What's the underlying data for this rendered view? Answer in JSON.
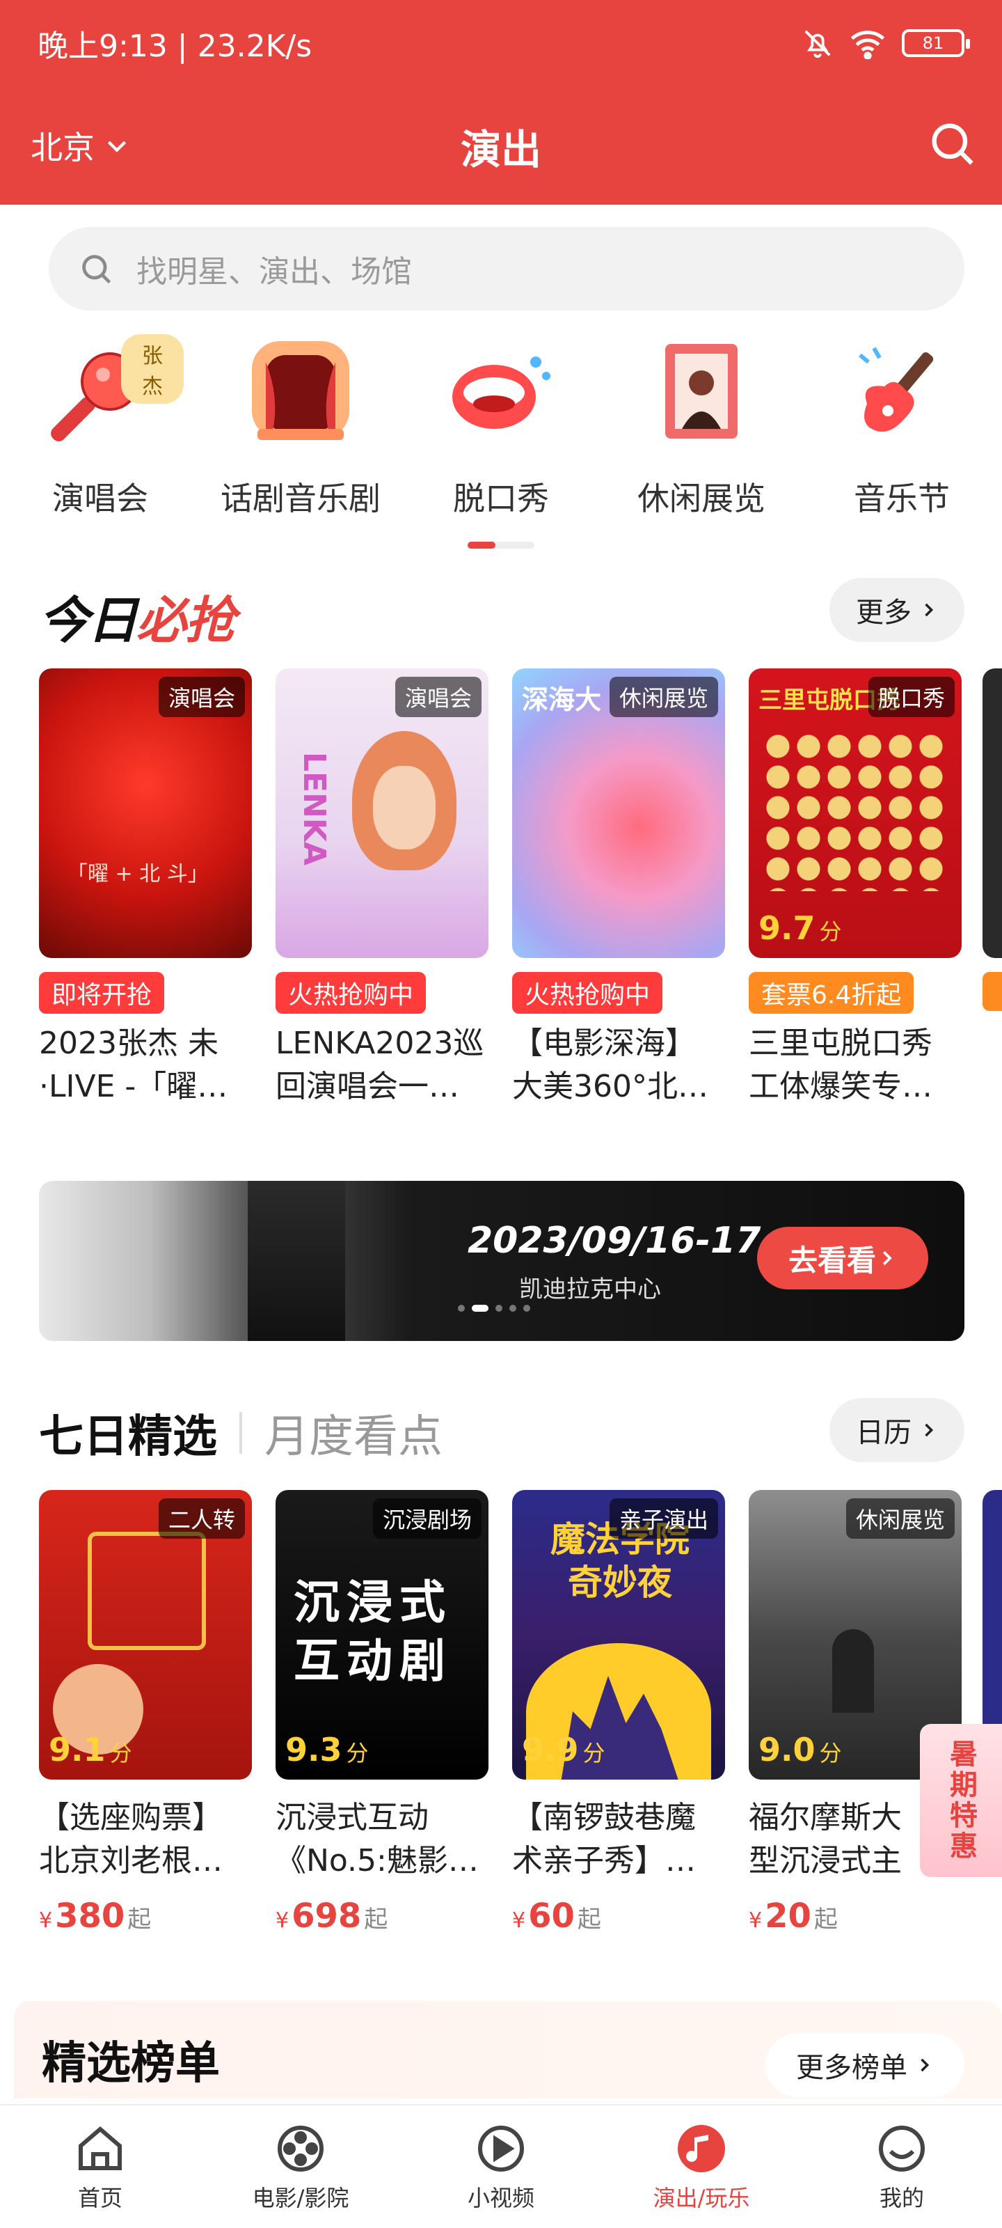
{
  "status_bar": {
    "text": "晚上9:13 | 23.2K/s",
    "battery": "81"
  },
  "header": {
    "city": "北京",
    "title": "演出"
  },
  "search": {
    "placeholder": "找明星、演出、场馆"
  },
  "categories": [
    {
      "label": "演唱会",
      "icon": "microphone-icon",
      "badge": "张杰"
    },
    {
      "label": "话剧音乐剧",
      "icon": "theater-stage-icon"
    },
    {
      "label": "脱口秀",
      "icon": "mouth-icon"
    },
    {
      "label": "休闲展览",
      "icon": "picture-frame-icon"
    },
    {
      "label": "音乐节",
      "icon": "electric-guitar-icon"
    }
  ],
  "today": {
    "title_a": "今日",
    "title_b": "必抢",
    "more": "更多",
    "cards": [
      {
        "tag": "演唱会",
        "badge": "即将开抢",
        "badge_color": "#ff3b3b",
        "title": "2023张杰 未·LIVE -「曜…",
        "poster_text": "「曜 + 北 斗」"
      },
      {
        "tag": "演唱会",
        "badge": "火热抢购中",
        "badge_color": "#ff3b3b",
        "title": "LENKA2023巡回演唱会一…",
        "poster_text": "LENKA"
      },
      {
        "tag": "休闲展览",
        "badge": "火热抢购中",
        "badge_color": "#ff3b3b",
        "title": "【电影深海】大美360°北…",
        "poster_text": "深海大"
      },
      {
        "tag": "脱口秀",
        "badge": "套票6.4折起",
        "badge_color": "#ff8a1f",
        "title": "三里屯脱口秀工体爆笑专…",
        "poster_text": "三里屯脱口秀",
        "score": "9.7",
        "score_unit": "分"
      }
    ]
  },
  "banner": {
    "date": "2023/09/16-17",
    "venue": "凯迪拉克中心",
    "button": "去看看"
  },
  "weekly": {
    "tab_active": "七日精选",
    "tab_other": "月度看点",
    "calendar": "日历",
    "cards": [
      {
        "tag": "二人转",
        "score": "9.1",
        "score_unit": "分",
        "title": "【选座购票】北京刘老根…",
        "price_symbol": "¥",
        "price": "380",
        "price_suffix": "起"
      },
      {
        "tag": "沉浸剧场",
        "score": "9.3",
        "score_unit": "分",
        "title": "沉浸式互动《No.5:魅影…",
        "price_symbol": "¥",
        "price": "698",
        "price_suffix": "起",
        "poster_text": "沉浸式互动剧"
      },
      {
        "tag": "亲子演出",
        "score": "9.9",
        "score_unit": "分",
        "title": "【南锣鼓巷魔术亲子秀】…",
        "price_symbol": "¥",
        "price": "60",
        "price_suffix": "起",
        "poster_text": "魔法学院奇妙夜"
      },
      {
        "tag": "休闲展览",
        "score": "9.0",
        "score_unit": "分",
        "title": "福尔摩斯大型沉浸式主题展…",
        "price_symbol": "¥",
        "price": "20",
        "price_suffix": "起"
      }
    ]
  },
  "summer": {
    "label": "暑期特惠"
  },
  "ranking": {
    "title": "精选榜单",
    "more": "更多榜单"
  },
  "bottom_nav": [
    {
      "label": "首页",
      "icon": "home-icon"
    },
    {
      "label": "电影/影院",
      "icon": "film-reel-icon"
    },
    {
      "label": "小视频",
      "icon": "play-icon"
    },
    {
      "label": "演出/玩乐",
      "icon": "music-note-icon",
      "active": true
    },
    {
      "label": "我的",
      "icon": "profile-icon"
    }
  ],
  "colors": {
    "brand": "#e7433f",
    "price": "#e7433f",
    "score": "#ffd23a"
  }
}
